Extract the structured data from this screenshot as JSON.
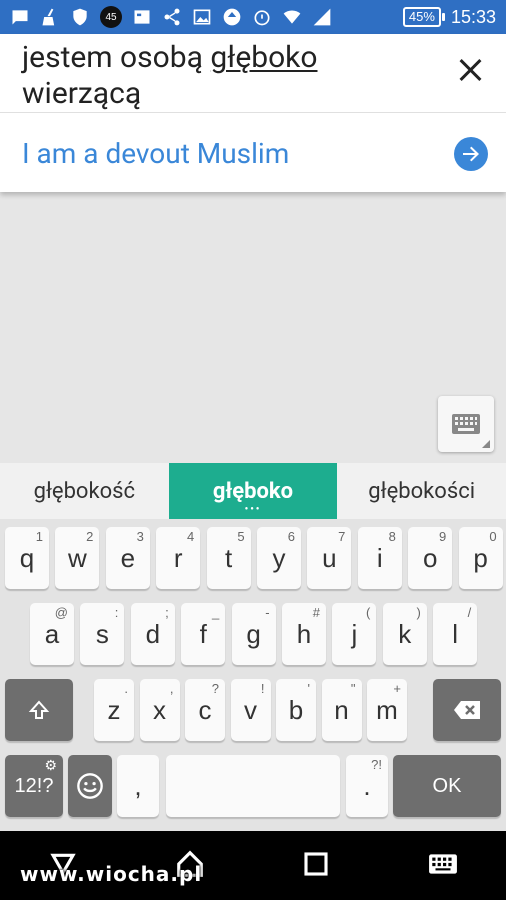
{
  "status_bar": {
    "notification_badge": "45",
    "battery": "45%",
    "time": "15:33"
  },
  "translate": {
    "source_text_plain": "jestem osobą ",
    "source_text_underlined": "głęboko",
    "source_text_rest": "wierzącą",
    "result_text": "I am a devout Muslim",
    "accent_color": "#3a87d8"
  },
  "suggestions": [
    "głębokość",
    "głęboko",
    "głębokości"
  ],
  "keyboard": {
    "row1": [
      {
        "k": "q",
        "h": "1"
      },
      {
        "k": "w",
        "h": "2"
      },
      {
        "k": "e",
        "h": "3"
      },
      {
        "k": "r",
        "h": "4"
      },
      {
        "k": "t",
        "h": "5"
      },
      {
        "k": "y",
        "h": "6"
      },
      {
        "k": "u",
        "h": "7"
      },
      {
        "k": "i",
        "h": "8"
      },
      {
        "k": "o",
        "h": "9"
      },
      {
        "k": "p",
        "h": "0"
      }
    ],
    "row2": [
      {
        "k": "a",
        "h": "@"
      },
      {
        "k": "s",
        "h": ":"
      },
      {
        "k": "d",
        "h": ";"
      },
      {
        "k": "f",
        "h": "_"
      },
      {
        "k": "g",
        "h": "-"
      },
      {
        "k": "h",
        "h": "#"
      },
      {
        "k": "j",
        "h": "("
      },
      {
        "k": "k",
        "h": ")"
      },
      {
        "k": "l",
        "h": "/"
      }
    ],
    "row3": [
      {
        "k": "z",
        "h": "."
      },
      {
        "k": "x",
        "h": ","
      },
      {
        "k": "c",
        "h": "?"
      },
      {
        "k": "v",
        "h": "!"
      },
      {
        "k": "b",
        "h": "'"
      },
      {
        "k": "n",
        "h": "\""
      },
      {
        "k": "m",
        "h": "+"
      }
    ],
    "symbols_label": "12!?",
    "comma": ",",
    "period": ".",
    "period_hint": "?!",
    "ok_label": "OK",
    "active_color": "#1dad8f"
  },
  "watermark": "www.wiocha.pl"
}
